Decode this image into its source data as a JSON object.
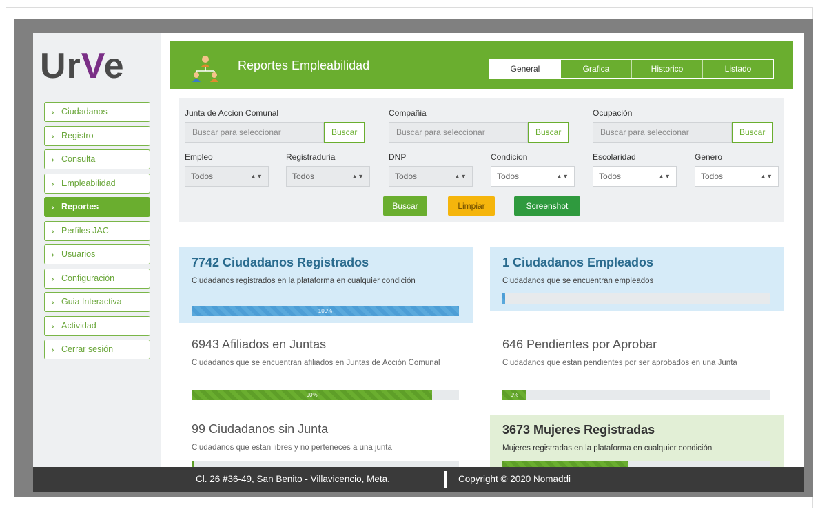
{
  "brand": {
    "logo_text_a": "Ur",
    "logo_text_v": "V",
    "logo_text_b": "e"
  },
  "sidebar": {
    "items": [
      {
        "label": "Ciudadanos"
      },
      {
        "label": "Registro"
      },
      {
        "label": "Consulta"
      },
      {
        "label": "Empleabilidad"
      },
      {
        "label": "Reportes",
        "active": true
      },
      {
        "label": "Perfiles JAC"
      },
      {
        "label": "Usuarios"
      },
      {
        "label": "Configuración"
      },
      {
        "label": "Guia Interactiva"
      },
      {
        "label": "Actividad"
      },
      {
        "label": "Cerrar sesión"
      }
    ]
  },
  "header": {
    "icon": "people-network-icon",
    "title": "Reportes Empleabilidad",
    "tabs": [
      {
        "label": "General",
        "active": true
      },
      {
        "label": "Grafica"
      },
      {
        "label": "Historico"
      },
      {
        "label": "Listado"
      }
    ]
  },
  "filters": {
    "junta": {
      "label": "Junta de Accion Comunal",
      "placeholder": "Buscar para seleccionar",
      "button": "Buscar"
    },
    "compania": {
      "label": "Compañia",
      "placeholder": "Buscar para seleccionar",
      "button": "Buscar"
    },
    "ocupacion": {
      "label": "Ocupación",
      "placeholder": "Buscar para seleccionar",
      "button": "Buscar"
    },
    "empleo": {
      "label": "Empleo",
      "value": "Todos"
    },
    "registraduria": {
      "label": "Registraduria",
      "value": "Todos"
    },
    "dnp": {
      "label": "DNP",
      "value": "Todos"
    },
    "condicion": {
      "label": "Condicion",
      "value": "Todos"
    },
    "escolaridad": {
      "label": "Escolaridad",
      "value": "Todos"
    },
    "genero": {
      "label": "Genero",
      "value": "Todos"
    },
    "actions": {
      "buscar": "Buscar",
      "limpiar": "Limpiar",
      "screenshot": "Screenshot"
    }
  },
  "stats": [
    {
      "title": "7742 Ciudadanos Registrados",
      "desc": "Ciudadanos registrados en la plataforma en cualquier condición",
      "percent": 100,
      "label": "100%"
    },
    {
      "title": "1 Ciudadanos Empleados",
      "desc": "Ciudadanos que se encuentran empleados",
      "percent": 0,
      "label": ""
    },
    {
      "title": "6943 Afiliados en Juntas",
      "desc": "Ciudadanos que se encuentran afiliados en Juntas de Acción Comunal",
      "percent": 90,
      "label": "90%"
    },
    {
      "title": "646 Pendientes por Aprobar",
      "desc": "Ciudadanos que estan pendientes por ser aprobados en una Junta",
      "percent": 9,
      "label": "9%"
    },
    {
      "title": "99 Ciudadanos sin Junta",
      "desc": "Ciudadanos que estan libres y no perteneces a una junta",
      "percent": 1,
      "label": ""
    },
    {
      "title": "3673 Mujeres Registradas",
      "desc": "Mujeres registradas en la plataforma en cualquier condición",
      "percent": 47,
      "label": ""
    }
  ],
  "footer": {
    "address": "Cl. 26 #36-49, San Benito - Villavicencio, Meta.",
    "copyright": "Copyright © 2020 Nomaddi"
  },
  "colors": {
    "green": "#6aae2f",
    "blue_card": "#d6ebf8",
    "green_card": "#e2efd6",
    "orange": "#f5b50c",
    "dark_green": "#2f9a3e"
  }
}
